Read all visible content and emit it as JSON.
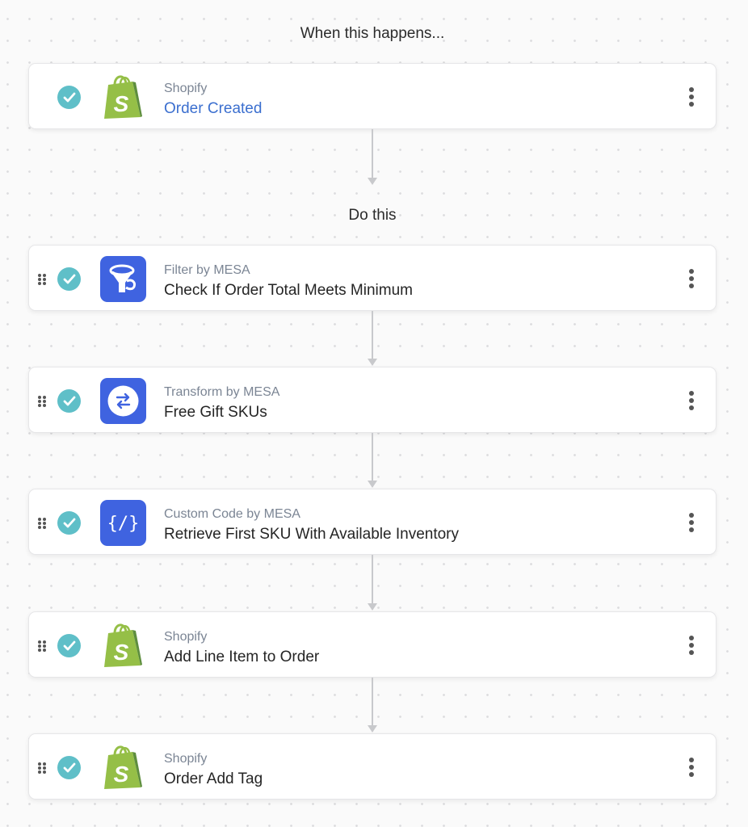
{
  "trigger_label": "When this happens...",
  "actions_label": "Do this",
  "colors": {
    "check": "#5fbfc8",
    "mesa_blue": "#3f63e0",
    "shopify_green": "#95bf47",
    "link_blue": "#3b6fcf"
  },
  "trigger": {
    "app": "Shopify",
    "title": "Order Created",
    "icon": "shopify-bag-icon",
    "status": "complete"
  },
  "steps": [
    {
      "app": "Filter by MESA",
      "title": "Check If Order Total Meets Minimum",
      "icon": "funnel-icon",
      "status": "complete"
    },
    {
      "app": "Transform by MESA",
      "title": "Free Gift SKUs",
      "icon": "swap-arrows-icon",
      "status": "complete"
    },
    {
      "app": "Custom Code by MESA",
      "title": "Retrieve First SKU With Available Inventory",
      "icon": "code-braces-icon",
      "status": "complete"
    },
    {
      "app": "Shopify",
      "title": "Add Line Item to Order",
      "icon": "shopify-bag-icon",
      "status": "complete"
    },
    {
      "app": "Shopify",
      "title": "Order Add Tag",
      "icon": "shopify-bag-icon",
      "status": "complete"
    }
  ]
}
